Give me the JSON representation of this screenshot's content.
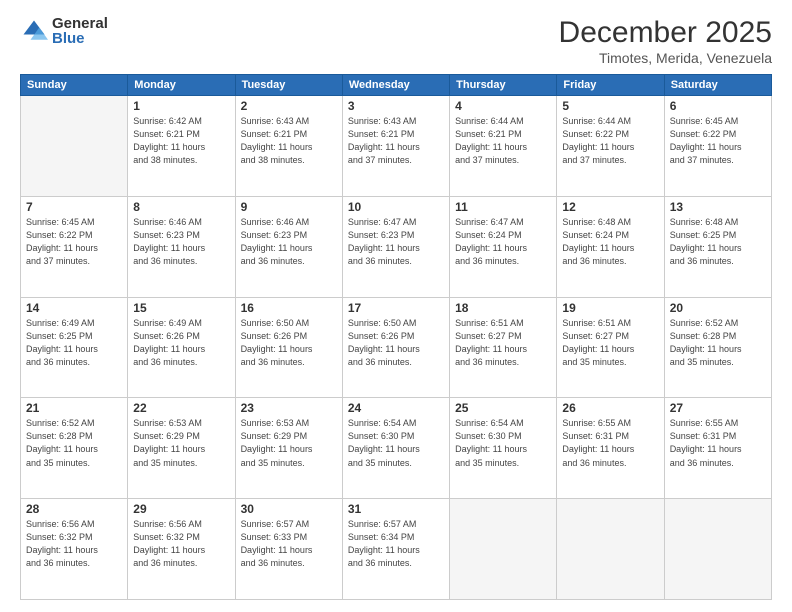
{
  "logo": {
    "general": "General",
    "blue": "Blue"
  },
  "header": {
    "month": "December 2025",
    "location": "Timotes, Merida, Venezuela"
  },
  "weekdays": [
    "Sunday",
    "Monday",
    "Tuesday",
    "Wednesday",
    "Thursday",
    "Friday",
    "Saturday"
  ],
  "weeks": [
    [
      {
        "day": "",
        "info": ""
      },
      {
        "day": "1",
        "info": "Sunrise: 6:42 AM\nSunset: 6:21 PM\nDaylight: 11 hours\nand 38 minutes."
      },
      {
        "day": "2",
        "info": "Sunrise: 6:43 AM\nSunset: 6:21 PM\nDaylight: 11 hours\nand 38 minutes."
      },
      {
        "day": "3",
        "info": "Sunrise: 6:43 AM\nSunset: 6:21 PM\nDaylight: 11 hours\nand 37 minutes."
      },
      {
        "day": "4",
        "info": "Sunrise: 6:44 AM\nSunset: 6:21 PM\nDaylight: 11 hours\nand 37 minutes."
      },
      {
        "day": "5",
        "info": "Sunrise: 6:44 AM\nSunset: 6:22 PM\nDaylight: 11 hours\nand 37 minutes."
      },
      {
        "day": "6",
        "info": "Sunrise: 6:45 AM\nSunset: 6:22 PM\nDaylight: 11 hours\nand 37 minutes."
      }
    ],
    [
      {
        "day": "7",
        "info": "Sunrise: 6:45 AM\nSunset: 6:22 PM\nDaylight: 11 hours\nand 37 minutes."
      },
      {
        "day": "8",
        "info": "Sunrise: 6:46 AM\nSunset: 6:23 PM\nDaylight: 11 hours\nand 36 minutes."
      },
      {
        "day": "9",
        "info": "Sunrise: 6:46 AM\nSunset: 6:23 PM\nDaylight: 11 hours\nand 36 minutes."
      },
      {
        "day": "10",
        "info": "Sunrise: 6:47 AM\nSunset: 6:23 PM\nDaylight: 11 hours\nand 36 minutes."
      },
      {
        "day": "11",
        "info": "Sunrise: 6:47 AM\nSunset: 6:24 PM\nDaylight: 11 hours\nand 36 minutes."
      },
      {
        "day": "12",
        "info": "Sunrise: 6:48 AM\nSunset: 6:24 PM\nDaylight: 11 hours\nand 36 minutes."
      },
      {
        "day": "13",
        "info": "Sunrise: 6:48 AM\nSunset: 6:25 PM\nDaylight: 11 hours\nand 36 minutes."
      }
    ],
    [
      {
        "day": "14",
        "info": "Sunrise: 6:49 AM\nSunset: 6:25 PM\nDaylight: 11 hours\nand 36 minutes."
      },
      {
        "day": "15",
        "info": "Sunrise: 6:49 AM\nSunset: 6:26 PM\nDaylight: 11 hours\nand 36 minutes."
      },
      {
        "day": "16",
        "info": "Sunrise: 6:50 AM\nSunset: 6:26 PM\nDaylight: 11 hours\nand 36 minutes."
      },
      {
        "day": "17",
        "info": "Sunrise: 6:50 AM\nSunset: 6:26 PM\nDaylight: 11 hours\nand 36 minutes."
      },
      {
        "day": "18",
        "info": "Sunrise: 6:51 AM\nSunset: 6:27 PM\nDaylight: 11 hours\nand 36 minutes."
      },
      {
        "day": "19",
        "info": "Sunrise: 6:51 AM\nSunset: 6:27 PM\nDaylight: 11 hours\nand 35 minutes."
      },
      {
        "day": "20",
        "info": "Sunrise: 6:52 AM\nSunset: 6:28 PM\nDaylight: 11 hours\nand 35 minutes."
      }
    ],
    [
      {
        "day": "21",
        "info": "Sunrise: 6:52 AM\nSunset: 6:28 PM\nDaylight: 11 hours\nand 35 minutes."
      },
      {
        "day": "22",
        "info": "Sunrise: 6:53 AM\nSunset: 6:29 PM\nDaylight: 11 hours\nand 35 minutes."
      },
      {
        "day": "23",
        "info": "Sunrise: 6:53 AM\nSunset: 6:29 PM\nDaylight: 11 hours\nand 35 minutes."
      },
      {
        "day": "24",
        "info": "Sunrise: 6:54 AM\nSunset: 6:30 PM\nDaylight: 11 hours\nand 35 minutes."
      },
      {
        "day": "25",
        "info": "Sunrise: 6:54 AM\nSunset: 6:30 PM\nDaylight: 11 hours\nand 35 minutes."
      },
      {
        "day": "26",
        "info": "Sunrise: 6:55 AM\nSunset: 6:31 PM\nDaylight: 11 hours\nand 36 minutes."
      },
      {
        "day": "27",
        "info": "Sunrise: 6:55 AM\nSunset: 6:31 PM\nDaylight: 11 hours\nand 36 minutes."
      }
    ],
    [
      {
        "day": "28",
        "info": "Sunrise: 6:56 AM\nSunset: 6:32 PM\nDaylight: 11 hours\nand 36 minutes."
      },
      {
        "day": "29",
        "info": "Sunrise: 6:56 AM\nSunset: 6:32 PM\nDaylight: 11 hours\nand 36 minutes."
      },
      {
        "day": "30",
        "info": "Sunrise: 6:57 AM\nSunset: 6:33 PM\nDaylight: 11 hours\nand 36 minutes."
      },
      {
        "day": "31",
        "info": "Sunrise: 6:57 AM\nSunset: 6:34 PM\nDaylight: 11 hours\nand 36 minutes."
      },
      {
        "day": "",
        "info": ""
      },
      {
        "day": "",
        "info": ""
      },
      {
        "day": "",
        "info": ""
      }
    ]
  ]
}
